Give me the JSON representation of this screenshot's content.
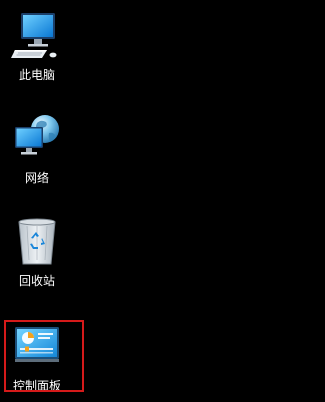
{
  "desktop": {
    "background": "#000000",
    "highlight_color": "#d51a1a",
    "icons": [
      {
        "label": "此电脑",
        "icon": "computer-icon",
        "selected": false
      },
      {
        "label": "网络",
        "icon": "network-globe-icon",
        "selected": false
      },
      {
        "label": "回收站",
        "icon": "recycle-bin-icon",
        "selected": false
      },
      {
        "label": "控制面板",
        "icon": "control-panel-icon",
        "selected": true
      }
    ]
  }
}
